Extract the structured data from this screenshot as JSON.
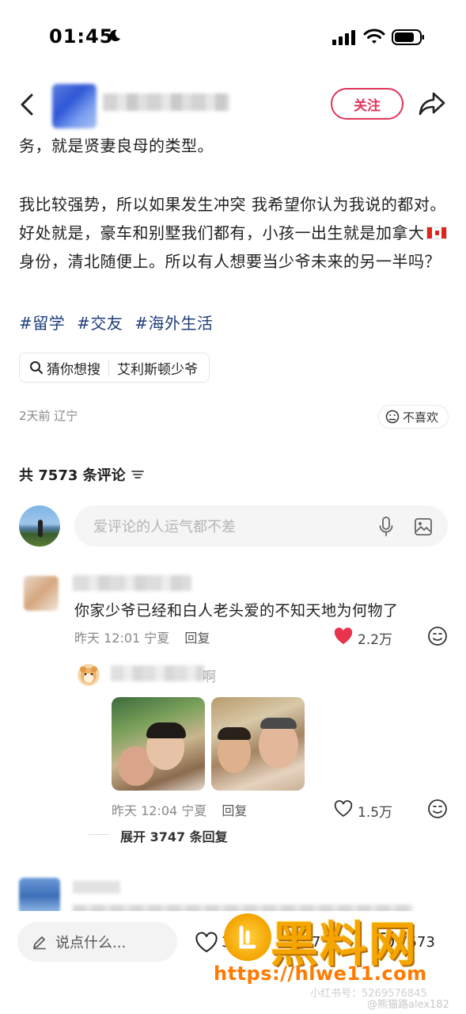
{
  "status_bar": {
    "time": "01:45"
  },
  "nav": {
    "follow_label": "关注"
  },
  "post": {
    "line_continued": "务，就是贤妻良母的类型。",
    "para_part1": "我比较强势，所以如果发生冲突 我希望你认为我说的都对。好处就是，豪车和别墅我们都有，小孩一出生就是加拿大",
    "para_part2": "身份，清北随便上。所以有人想要当少爷未来的另一半吗？",
    "tags": [
      "#留学",
      "#交友",
      "#海外生活"
    ],
    "search_chip": {
      "label": "猜你想搜",
      "query": "艾利斯顿少爷"
    },
    "meta": "2天前 辽宁",
    "dislike_label": "不喜欢"
  },
  "comments": {
    "header": "共 7573 条评论",
    "input_placeholder": "爱评论的人运气都不差",
    "items": [
      {
        "text": "你家少爷已经和白人老头爱的不知天地为何物了",
        "time": "昨天 12:01",
        "location": "宁夏",
        "reply_label": "回复",
        "likes": "2.2万"
      }
    ],
    "reply": {
      "name_tail": "啊",
      "time": "昨天 12:04",
      "location": "宁夏",
      "reply_label": "回复",
      "likes": "1.5万",
      "expand_label": "展开 3747 条回复"
    }
  },
  "bottom_bar": {
    "say_placeholder": "说点什么...",
    "likes": "3019",
    "favorites": "7",
    "comments": "7573"
  },
  "watermark": {
    "brand": "黑料网",
    "url": "https://hlwe11.com",
    "small1": "小红书号：5269576845",
    "small2": "@熊猫路alex182"
  },
  "colors": {
    "accent": "#e0355b",
    "tag": "#1f3d7a",
    "watermark": "#f5a500"
  }
}
